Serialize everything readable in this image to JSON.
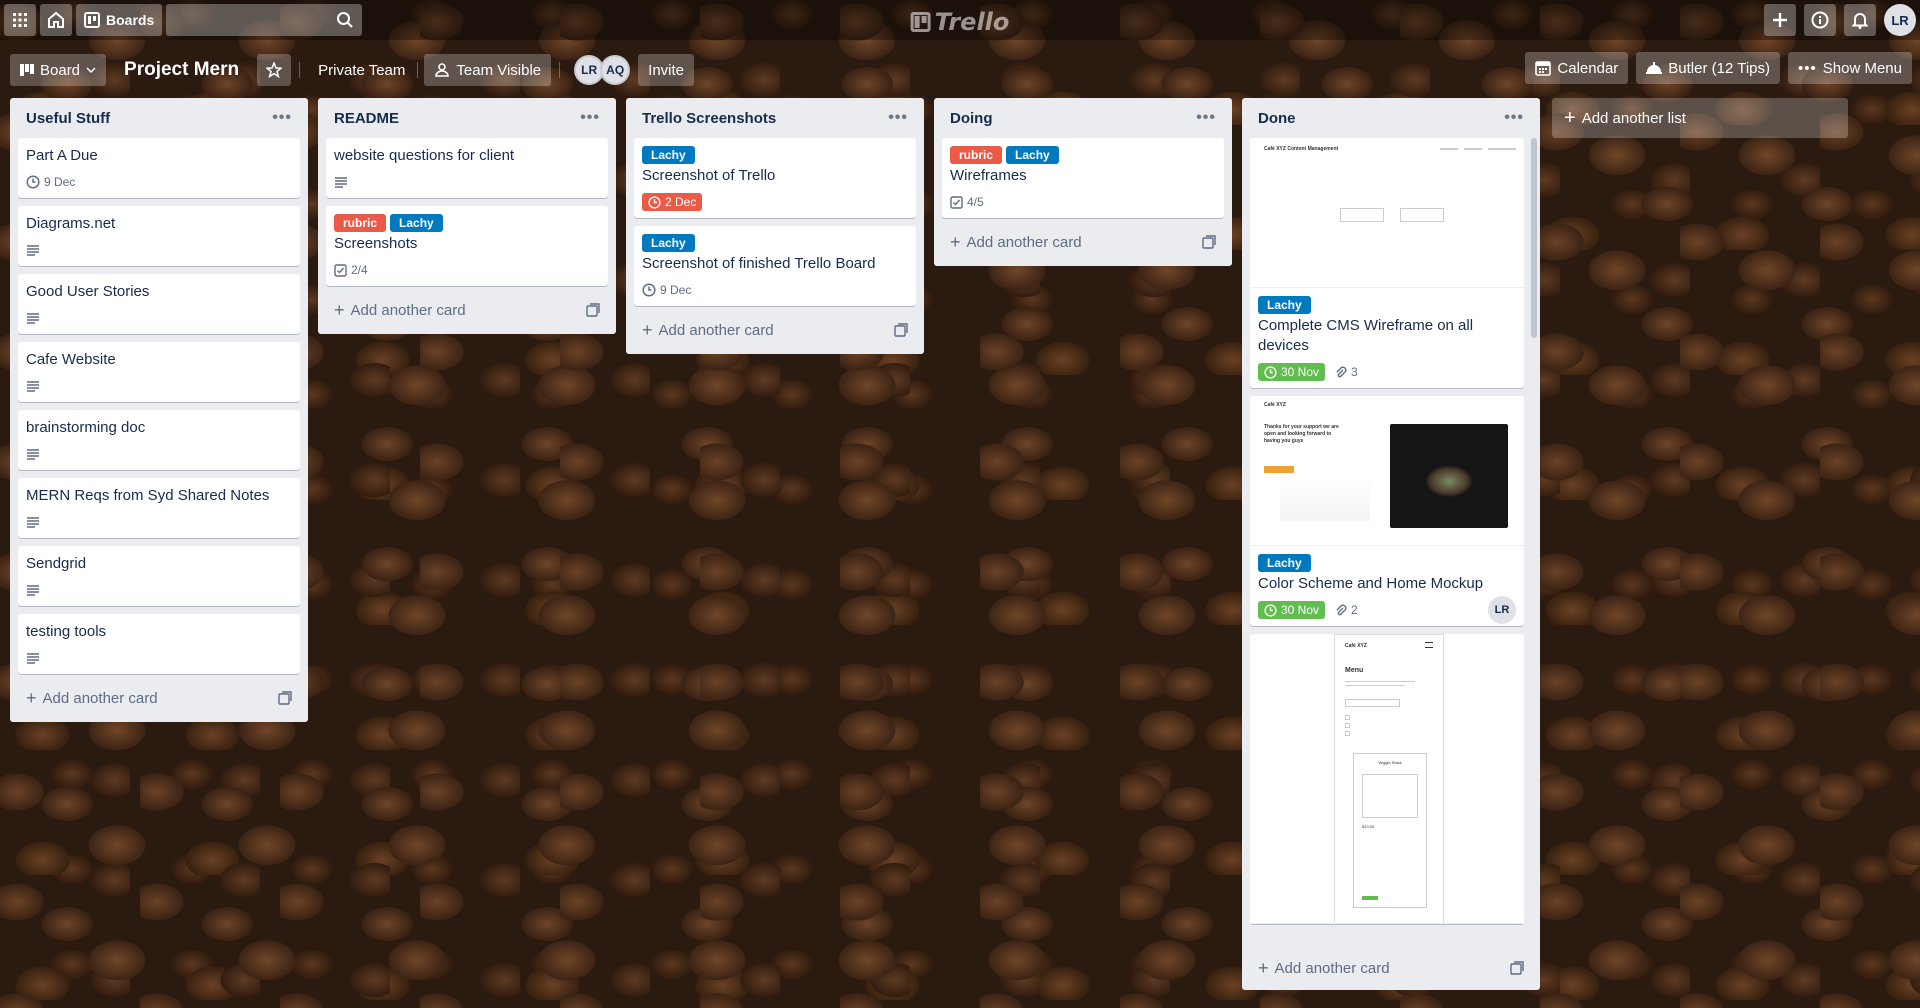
{
  "topbar": {
    "apps_icon": "apps-grid-icon",
    "home_icon": "home-icon",
    "boards_label": "Boards",
    "search_icon": "search-icon",
    "logo_text": "Trello",
    "right_icons": [
      "plus-icon",
      "info-icon",
      "bell-icon"
    ],
    "user_initials": "LR"
  },
  "boardbar": {
    "board_switch_label": "Board",
    "board_title": "Project Mern",
    "team_label": "Private Team",
    "visibility_label": "Team Visible",
    "members": [
      "LR",
      "AQ"
    ],
    "invite_label": "Invite",
    "calendar_label": "Calendar",
    "butler_label": "Butler (12 Tips)",
    "menu_label": "Show Menu"
  },
  "colors": {
    "label_blue": "#0079bf",
    "label_red": "#eb5a46",
    "due_green": "#61bd4f",
    "due_red": "#eb5a46",
    "list_bg": "#ebecf0"
  },
  "lists": [
    {
      "title": "Useful Stuff",
      "cards": [
        {
          "title": "Part A Due",
          "due": "9 Dec"
        },
        {
          "title": "Diagrams.net"
        },
        {
          "title": "Good User Stories"
        },
        {
          "title": "Cafe Website"
        },
        {
          "title": "brainstorming doc"
        },
        {
          "title": "MERN Reqs from Syd Shared Notes"
        },
        {
          "title": "Sendgrid"
        },
        {
          "title": "testing tools"
        }
      ],
      "add_card": "Add another card"
    },
    {
      "title": "README",
      "cards": [
        {
          "title": "website questions for client"
        },
        {
          "title": "Screenshots",
          "labels": [
            "rubric",
            "Lachy"
          ],
          "checklist": "2/4"
        }
      ],
      "add_card": "Add another card"
    },
    {
      "title": "Trello Screenshots",
      "cards": [
        {
          "title": "Screenshot of Trello",
          "labels": [
            "Lachy"
          ],
          "due": "2 Dec"
        },
        {
          "title": "Screenshot of finished Trello Board",
          "labels": [
            "Lachy"
          ],
          "due": "9 Dec"
        }
      ],
      "add_card": "Add another card"
    },
    {
      "title": "Doing",
      "cards": [
        {
          "title": "Wireframes",
          "labels": [
            "rubric",
            "Lachy"
          ],
          "checklist": "4/5"
        }
      ],
      "add_card": "Add another card"
    },
    {
      "title": "Done",
      "cards": [
        {
          "title": "Complete CMS Wireframe on all devices",
          "labels": [
            "Lachy"
          ],
          "due": "30 Nov",
          "attachments": "3",
          "cover_text": "Café XYZ Content Management"
        },
        {
          "title": "Color Scheme and Home Mockup",
          "labels": [
            "Lachy"
          ],
          "due": "30 Nov",
          "attachments": "2",
          "member": "LR",
          "cover_heading": "Thanks for your support we are open and looking forward to having you guys",
          "cover_brand": "Café XYZ"
        },
        {
          "cover_brand": "Café XYZ",
          "cover_heading": "Menu",
          "cover_item": "Veggie Stack",
          "cover_price": "$10.00"
        }
      ],
      "add_card": "Add another card"
    }
  ],
  "add_list": "Add another list"
}
